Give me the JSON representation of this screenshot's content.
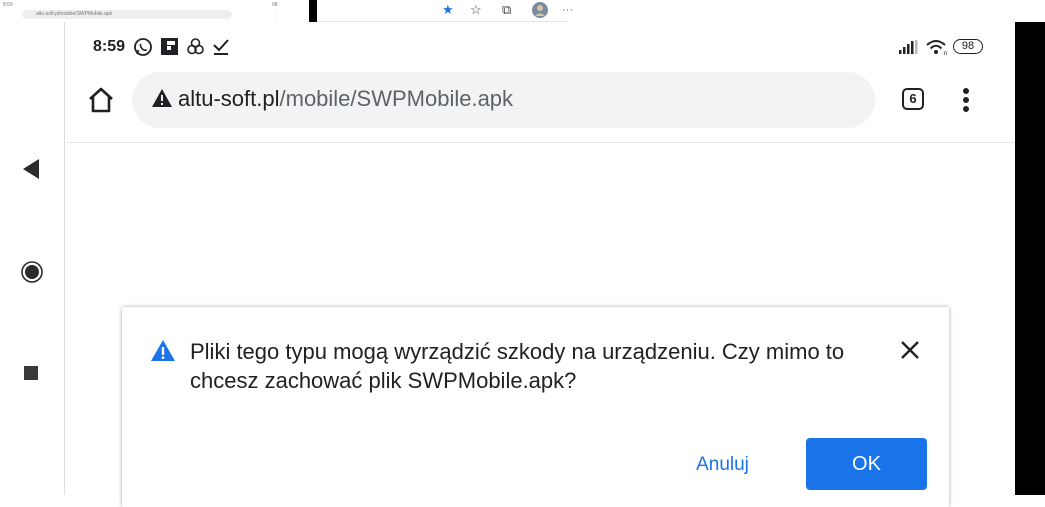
{
  "thumbnail": {
    "status_time": "8:59",
    "url": "altu-soft.pl/mobile/SWPMobile.apk",
    "status_right": "98"
  },
  "status_bar": {
    "time": "8:59",
    "battery": "98"
  },
  "address_bar": {
    "host": "altu-soft.pl",
    "path": "/mobile/SWPMobile.apk",
    "tab_count": "6"
  },
  "dialog": {
    "message": "Pliki tego typu mogą wyrządzić szkody na urządzeniu. Czy mimo to chcesz zachować plik SWPMobile.apk?",
    "cancel_label": "Anuluj",
    "ok_label": "OK"
  },
  "colors": {
    "accent": "#1a73e8",
    "warning_icon": "#1a73e8",
    "text": "#202124"
  },
  "icons": [
    "whatsapp-icon",
    "flipboard-icon",
    "browser-icon",
    "download-done-icon",
    "signal-icon",
    "wifi-icon",
    "battery-icon",
    "home-icon",
    "warning-icon",
    "tabs-icon",
    "more-icon",
    "back-icon",
    "nav-home-icon",
    "recents-icon",
    "close-icon",
    "star-icon",
    "favorites-icon",
    "collections-icon",
    "profile-icon",
    "ellipsis-icon"
  ]
}
